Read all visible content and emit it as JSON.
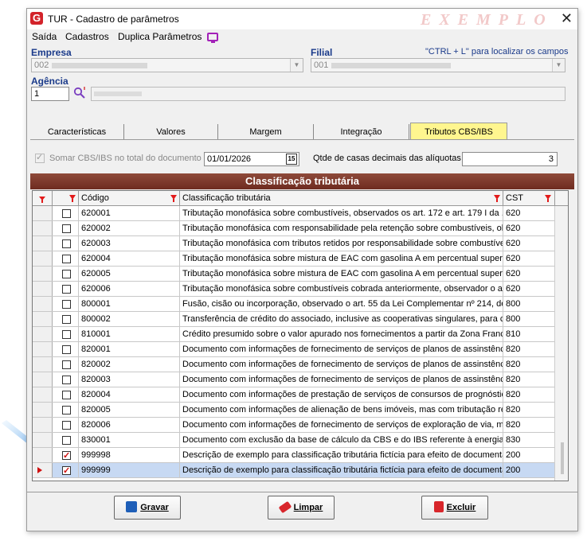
{
  "window": {
    "title": "TUR - Cadastro de parâmetros",
    "watermark": "EXEMPLO",
    "close_glyph": "✕"
  },
  "menu": {
    "items": [
      "Saída",
      "Cadastros",
      "Duplica Parâmetros"
    ],
    "icon": "monitor-icon"
  },
  "header": {
    "empresa_label": "Empresa",
    "empresa_value": "002",
    "filial_label": "Filial",
    "filial_value": "001",
    "hint": "\"CTRL + L\" para localizar os campos",
    "agencia_label": "Agência",
    "agencia_value": "1"
  },
  "tabs": {
    "items": [
      "Características",
      "Valores",
      "Margem",
      "Integração",
      "Tributos CBS/IBS"
    ],
    "active_index": 4
  },
  "options": {
    "somar_label": "Somar CBS/IBS no total do documento",
    "date_value": "01/01/2026",
    "calendar_glyph": "15",
    "decimais_label": "Qtde de casas decimais das alíquotas",
    "decimais_value": "3"
  },
  "grid": {
    "section_title": "Classificação tributária",
    "headers": {
      "codigo": "Código",
      "classificacao": "Classificação tributária",
      "cst": "CST"
    },
    "rows": [
      {
        "checked": false,
        "codigo": "620001",
        "classificacao": "Tributação monofásica sobre combustíveis, observados os art. 172 e   art. 179 I da ...",
        "cst": "620"
      },
      {
        "checked": false,
        "codigo": "620002",
        "classificacao": "Tributação monofásica com responsabilidade pela retenção sobre combustíveis, ob...",
        "cst": "620"
      },
      {
        "checked": false,
        "codigo": "620003",
        "classificacao": "Tributação monofásica com tributos retidos por responsabilidade sobre combustívei...",
        "cst": "620"
      },
      {
        "checked": false,
        "codigo": "620004",
        "classificacao": "Tributação monofásica sobre mistura de EAC com gasolina A em percentual superio...",
        "cst": "620"
      },
      {
        "checked": false,
        "codigo": "620005",
        "classificacao": "Tributação monofásica sobre mistura de EAC com gasolina A em percentual superio...",
        "cst": "620"
      },
      {
        "checked": false,
        "codigo": "620006",
        "classificacao": "Tributação monofásica sobre combustíveis cobrada anteriormente, observador o art...",
        "cst": "620"
      },
      {
        "checked": false,
        "codigo": "800001",
        "classificacao": "Fusão, cisão ou incorporação, observado o art. 55 da Lei Complementar nº 214, de ...",
        "cst": "800"
      },
      {
        "checked": false,
        "codigo": "800002",
        "classificacao": "Transferência de crédito do associado, inclusive as cooperativas singulares, para c...",
        "cst": "800"
      },
      {
        "checked": false,
        "codigo": "810001",
        "classificacao": "Crédito presumido sobre o valor apurado nos fornecimentos a partir da Zona Franca...",
        "cst": "810"
      },
      {
        "checked": false,
        "codigo": "820001",
        "classificacao": "Documento com informações de fornecimento de serviços de planos de assinstênci...",
        "cst": "820"
      },
      {
        "checked": false,
        "codigo": "820002",
        "classificacao": "Documento com informações de fornecimento de serviços de planos de assinstênci...",
        "cst": "820"
      },
      {
        "checked": false,
        "codigo": "820003",
        "classificacao": "Documento com informações de fornecimento de serviços de planos de assinstênci...",
        "cst": "820"
      },
      {
        "checked": false,
        "codigo": "820004",
        "classificacao": "Documento com informações de prestação de serviços de consursos de prognóstic...",
        "cst": "820"
      },
      {
        "checked": false,
        "codigo": "820005",
        "classificacao": "Documento com informações de alienação de bens imóveis, mas com tributação re...",
        "cst": "820"
      },
      {
        "checked": false,
        "codigo": "820006",
        "classificacao": "Documento com informações de fornecimento de serviços de exploração de via, m...",
        "cst": "820"
      },
      {
        "checked": false,
        "codigo": "830001",
        "classificacao": "Documento com  exclusão da base de cálculo da CBS e do IBS referente à energia ...",
        "cst": "830"
      },
      {
        "checked": true,
        "codigo": "999998",
        "classificacao": "Descrição de exemplo para classificação tributária fictícia para efeito de documenta...",
        "cst": "200"
      },
      {
        "checked": true,
        "codigo": "999999",
        "classificacao": "Descrição de exemplo para classificação tributária fictícia para efeito de documenta...",
        "cst": "200",
        "selected": true
      }
    ]
  },
  "buttons": {
    "gravar": "Gravar",
    "limpar": "Limpar",
    "excluir": "Excluir"
  },
  "colors": {
    "accent": "#d3232a",
    "active_tab": "#fff68f",
    "group_header": "#7a3426",
    "selection": "#c7d9f3",
    "link_label": "#1a3a8a"
  }
}
